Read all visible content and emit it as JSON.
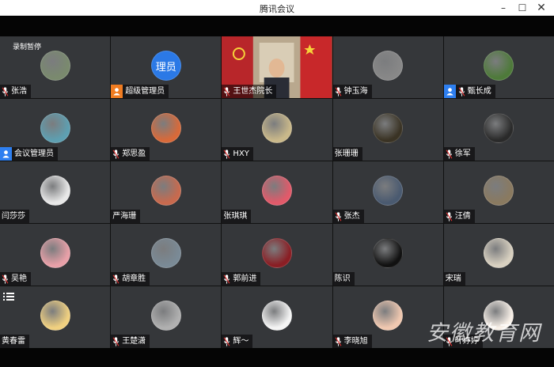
{
  "window": {
    "title": "腾讯会议"
  },
  "recording_status": "录制暂停",
  "watermark": "安徽教育网",
  "participants": [
    {
      "name": "张浩",
      "avatar": "landscape-avatar",
      "color": "#7a8a6e",
      "badge": null,
      "mic": true
    },
    {
      "name": "超级管理员",
      "avatar": "text-avatar",
      "avatar_text": "理员",
      "color": "#2b79e6",
      "badge": "host",
      "mic": false
    },
    {
      "name": "王世杰院长",
      "avatar": "video",
      "color": "#6b3a2e",
      "badge": null,
      "mic": true
    },
    {
      "name": "钟玉海",
      "avatar": "calligraphy-avatar",
      "color": "#888888",
      "badge": null,
      "mic": true
    },
    {
      "name": "甄长成",
      "avatar": "landscape-avatar",
      "color": "#4e7a3a",
      "badge": "cohost",
      "mic": true
    },
    {
      "name": "会议管理员",
      "avatar": "tower-avatar",
      "color": "#5e9fb1",
      "badge": "cohost",
      "mic": false
    },
    {
      "name": "郑思盈",
      "avatar": "colorful-avatar",
      "color": "#d86a3a",
      "badge": null,
      "mic": true
    },
    {
      "name": "HXY",
      "avatar": "flower-avatar",
      "color": "#c9b88a",
      "badge": null,
      "mic": true
    },
    {
      "name": "张珊珊",
      "avatar": "person-avatar",
      "color": "#3a3324",
      "badge": null,
      "mic": false
    },
    {
      "name": "徐军",
      "avatar": "person-avatar",
      "color": "#2a2a2a",
      "badge": null,
      "mic": true
    },
    {
      "name": "闫莎莎",
      "avatar": "person-avatar",
      "color": "#e8e8e8",
      "badge": null,
      "mic": false
    },
    {
      "name": "严海珊",
      "avatar": "fruit-avatar",
      "color": "#c86a4e",
      "badge": null,
      "mic": false
    },
    {
      "name": "张琪琪",
      "avatar": "cartoon-avatar",
      "color": "#e25a6a",
      "badge": null,
      "mic": false
    },
    {
      "name": "张杰",
      "avatar": "car-avatar",
      "color": "#4a5a70",
      "badge": null,
      "mic": true
    },
    {
      "name": "汪倩",
      "avatar": "person-avatar",
      "color": "#8a7a60",
      "badge": null,
      "mic": true
    },
    {
      "name": "吴艳",
      "avatar": "flower-avatar",
      "color": "#e8a0a8",
      "badge": null,
      "mic": true
    },
    {
      "name": "胡章胜",
      "avatar": "lighthouse-avatar",
      "color": "#7a8a96",
      "badge": null,
      "mic": true
    },
    {
      "name": "郭前进",
      "avatar": "theater-avatar",
      "color": "#8a1e24",
      "badge": null,
      "mic": true
    },
    {
      "name": "陈识",
      "avatar": "logo-avatar",
      "color": "#111111",
      "badge": null,
      "mic": false
    },
    {
      "name": "宋瑞",
      "avatar": "flower-avatar",
      "color": "#d8d0c0",
      "badge": null,
      "mic": false
    },
    {
      "name": "黄春雷",
      "avatar": "poster-avatar",
      "color": "#f0d080",
      "badge": null,
      "mic": false
    },
    {
      "name": "王楚潇",
      "avatar": "cat-avatar",
      "color": "#b0b0b0",
      "badge": null,
      "mic": true
    },
    {
      "name": "辉～",
      "avatar": "drawing-avatar",
      "color": "#f4f4f4",
      "badge": null,
      "mic": true
    },
    {
      "name": "李晓旭",
      "avatar": "cartoon-avatar",
      "color": "#f0c8b0",
      "badge": null,
      "mic": true
    },
    {
      "name": "叶婷婷",
      "avatar": "cartoon-avatar",
      "color": "#f8f0e8",
      "badge": null,
      "mic": true
    }
  ]
}
